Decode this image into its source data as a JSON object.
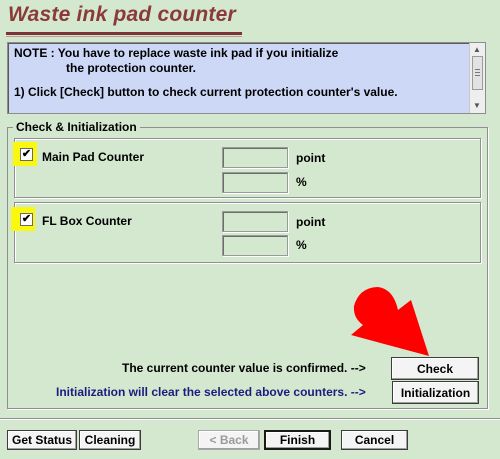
{
  "title": "Waste ink pad counter",
  "note": {
    "line1": "NOTE : You have to replace waste ink pad if you initialize",
    "line2": "the protection counter.",
    "line3": "1) Click [Check] button to check current protection counter's value."
  },
  "group": {
    "label": "Check & Initialization"
  },
  "counters": [
    {
      "label": "Main Pad Counter",
      "checked": true,
      "point_value": "",
      "percent_value": "",
      "point_unit": "point",
      "percent_unit": "%"
    },
    {
      "label": "FL Box Counter",
      "checked": true,
      "point_value": "",
      "percent_value": "",
      "point_unit": "point",
      "percent_unit": "%"
    }
  ],
  "check_message": "The current counter value is confirmed. -->",
  "init_message": "Initialization will clear the selected above counters. -->",
  "buttons": {
    "check": "Check",
    "initialization": "Initialization",
    "get_status": "Get Status",
    "cleaning": "Cleaning",
    "back": "< Back",
    "finish": "Finish",
    "cancel": "Cancel"
  },
  "checkmark_glyph": "✔",
  "colors": {
    "background": "#d4e8d0",
    "title": "#8b3a3a",
    "note_bg": "#cdd8f7",
    "highlight": "#fbf80f",
    "arrow": "#ff0000",
    "init_message": "#1c1c7e"
  }
}
